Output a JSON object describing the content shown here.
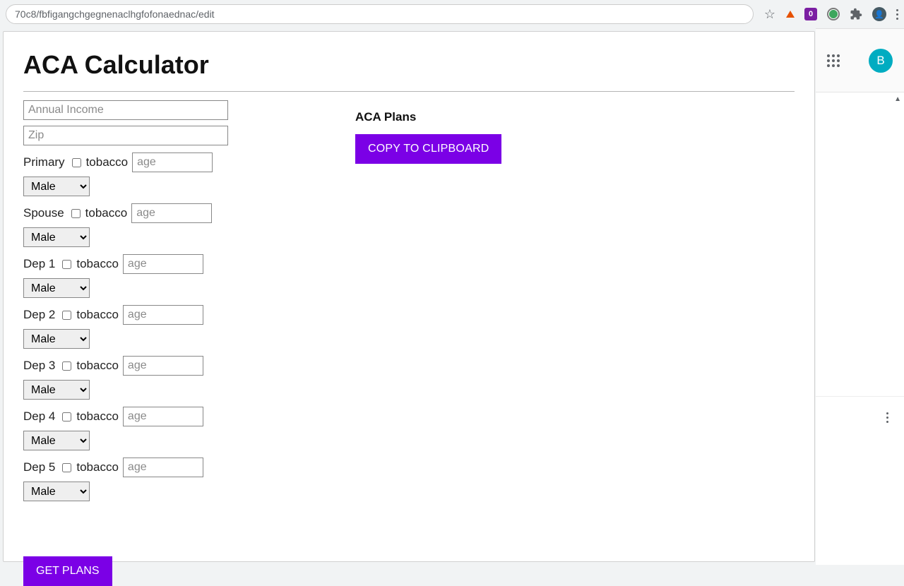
{
  "chrome": {
    "url_fragment": "70c8/fbfigangchgegnenaclhgfofonaednac/edit",
    "ext_badge_text": "0",
    "avatar_letter": "B"
  },
  "app": {
    "title": "ACA Calculator",
    "annual_income_placeholder": "Annual Income",
    "zip_placeholder": "Zip",
    "age_placeholder": "age",
    "tobacco_label": "tobacco",
    "gender_value": "Male",
    "persons": [
      {
        "label": "Primary"
      },
      {
        "label": "Spouse"
      },
      {
        "label": "Dep 1"
      },
      {
        "label": "Dep 2"
      },
      {
        "label": "Dep 3"
      },
      {
        "label": "Dep 4"
      },
      {
        "label": "Dep 5"
      }
    ],
    "get_plans_label": "GET PLANS",
    "plans_heading": "ACA Plans",
    "copy_label": "COPY TO CLIPBOARD"
  }
}
